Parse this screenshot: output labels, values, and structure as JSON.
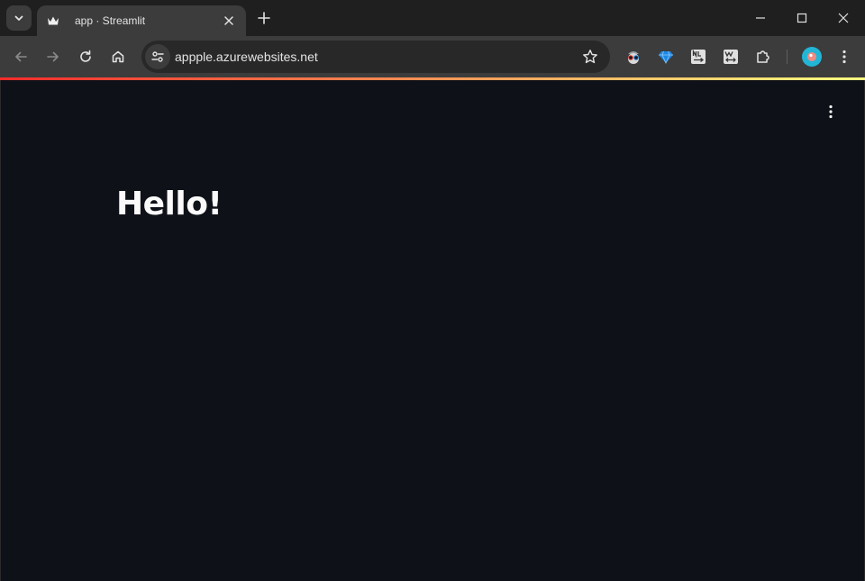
{
  "tab": {
    "title": "app · Streamlit"
  },
  "address_bar": {
    "url": "appple.azurewebsites.net"
  },
  "page": {
    "heading": "Hello!"
  },
  "colors": {
    "page_background": "#0e1117",
    "decoration_gradient_start": "#ff2b2b",
    "decoration_gradient_end": "#fffd80",
    "toolbar_background": "#3c3c3c",
    "profile_avatar": "#22b5d6"
  },
  "icons": {
    "tab_search": "chevron-down-icon",
    "favicon": "streamlit-crown-icon",
    "close_tab": "close-icon",
    "new_tab": "plus-icon",
    "back": "arrow-left-icon",
    "forward": "arrow-right-icon",
    "reload": "reload-icon",
    "home": "home-icon",
    "site_info": "tune-icon",
    "bookmark": "star-icon",
    "extensions": [
      "spy-glasses-icon",
      "diamond-icon",
      "nl-translate-icon",
      "word-swap-icon",
      "puzzle-icon"
    ],
    "browser_menu": "vertical-dots-icon",
    "app_menu": "vertical-dots-icon"
  }
}
